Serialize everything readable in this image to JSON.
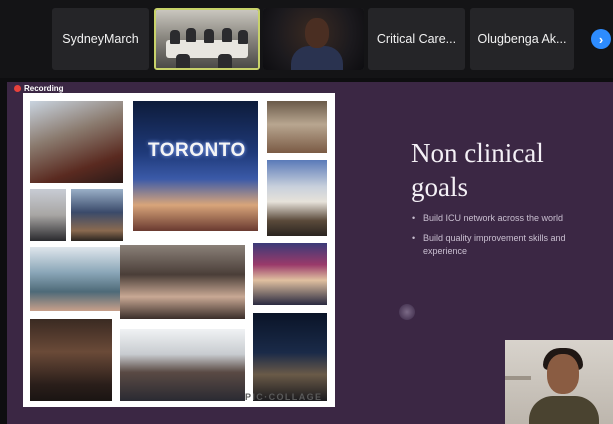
{
  "participants": [
    {
      "id": "p1",
      "name": "SydneyMarch",
      "type": "name"
    },
    {
      "id": "p2",
      "name": "",
      "type": "video-room",
      "active": true
    },
    {
      "id": "p3",
      "name": "",
      "type": "video-person"
    },
    {
      "id": "p4",
      "name": "Critical Care...",
      "type": "name"
    },
    {
      "id": "p5",
      "name": "Olugbenga Ak...",
      "type": "name"
    }
  ],
  "strip": {
    "next_icon": "chevron-right-icon",
    "next_glyph": "›"
  },
  "recording": {
    "label": "Recording",
    "color": "#e8413c"
  },
  "slide": {
    "title": "Non clinical goals",
    "bullets": [
      "Build ICU network across the world",
      "Build quality improvement skills and experience"
    ],
    "collage_sign_text": "TORONTO",
    "collage_watermark": "PIC·COLLAGE"
  },
  "colors": {
    "slide_bg": "#3b2744",
    "accent_blue": "#2d8cff",
    "active_border": "#c8d26a"
  }
}
